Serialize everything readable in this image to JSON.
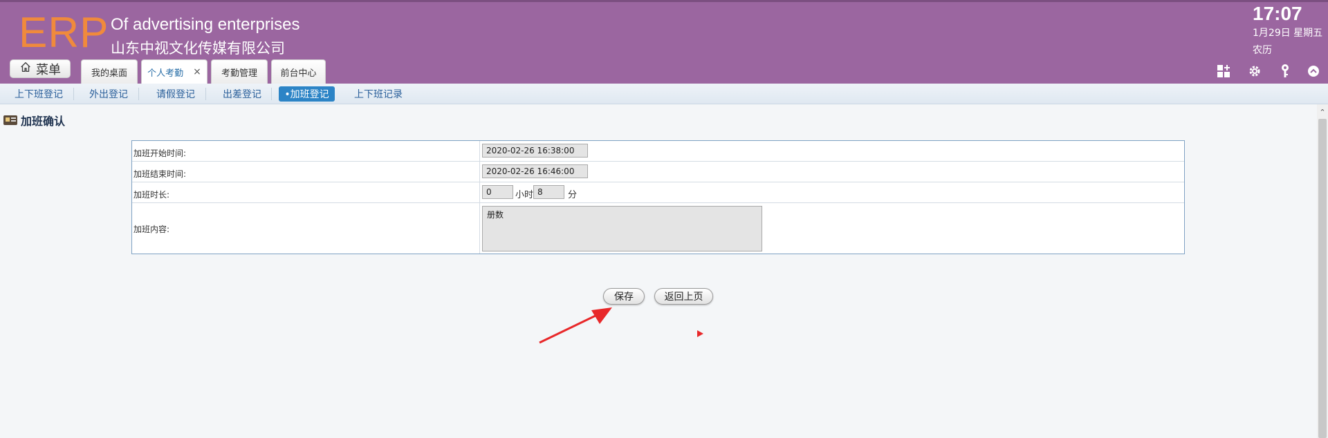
{
  "header": {
    "logo": "ERP",
    "company_en": "Of advertising enterprises",
    "company_cn": "山东中视文化传媒有限公司",
    "time": "17:07",
    "date": "1月29日 星期五",
    "lunar": "农历",
    "menu_label": "菜单",
    "tabs": [
      {
        "label": "我的桌面"
      },
      {
        "label": "个人考勤",
        "close": "×"
      },
      {
        "label": "考勤管理"
      },
      {
        "label": "前台中心"
      }
    ],
    "icons": [
      "grid-add-icon",
      "gear-icon",
      "key-icon",
      "collapse-icon"
    ]
  },
  "subnav": {
    "items": [
      "上下班登记",
      "外出登记",
      "请假登记",
      "出差登记",
      "•加班登记",
      "上下班记录"
    ],
    "active_index": 4
  },
  "page": {
    "title": "加班确认"
  },
  "form": {
    "start_label": "加班开始时间:",
    "start_value": "2020-02-26 16:38:00",
    "end_label": "加班结束时间:",
    "end_value": "2020-02-26 16:46:00",
    "duration_label": "加班时长:",
    "hours_value": "0",
    "hours_unit": "小时",
    "minutes_value": "8",
    "minutes_unit": "分",
    "content_label": "加班内容:",
    "content_value": "册数"
  },
  "actions": {
    "save_label": "保存",
    "back_label": "返回上页"
  },
  "colors": {
    "header_bg": "#9b66a0",
    "logo": "#f08a3c",
    "subnav_active": "#2c84c6",
    "arrow": "#e8282a"
  }
}
